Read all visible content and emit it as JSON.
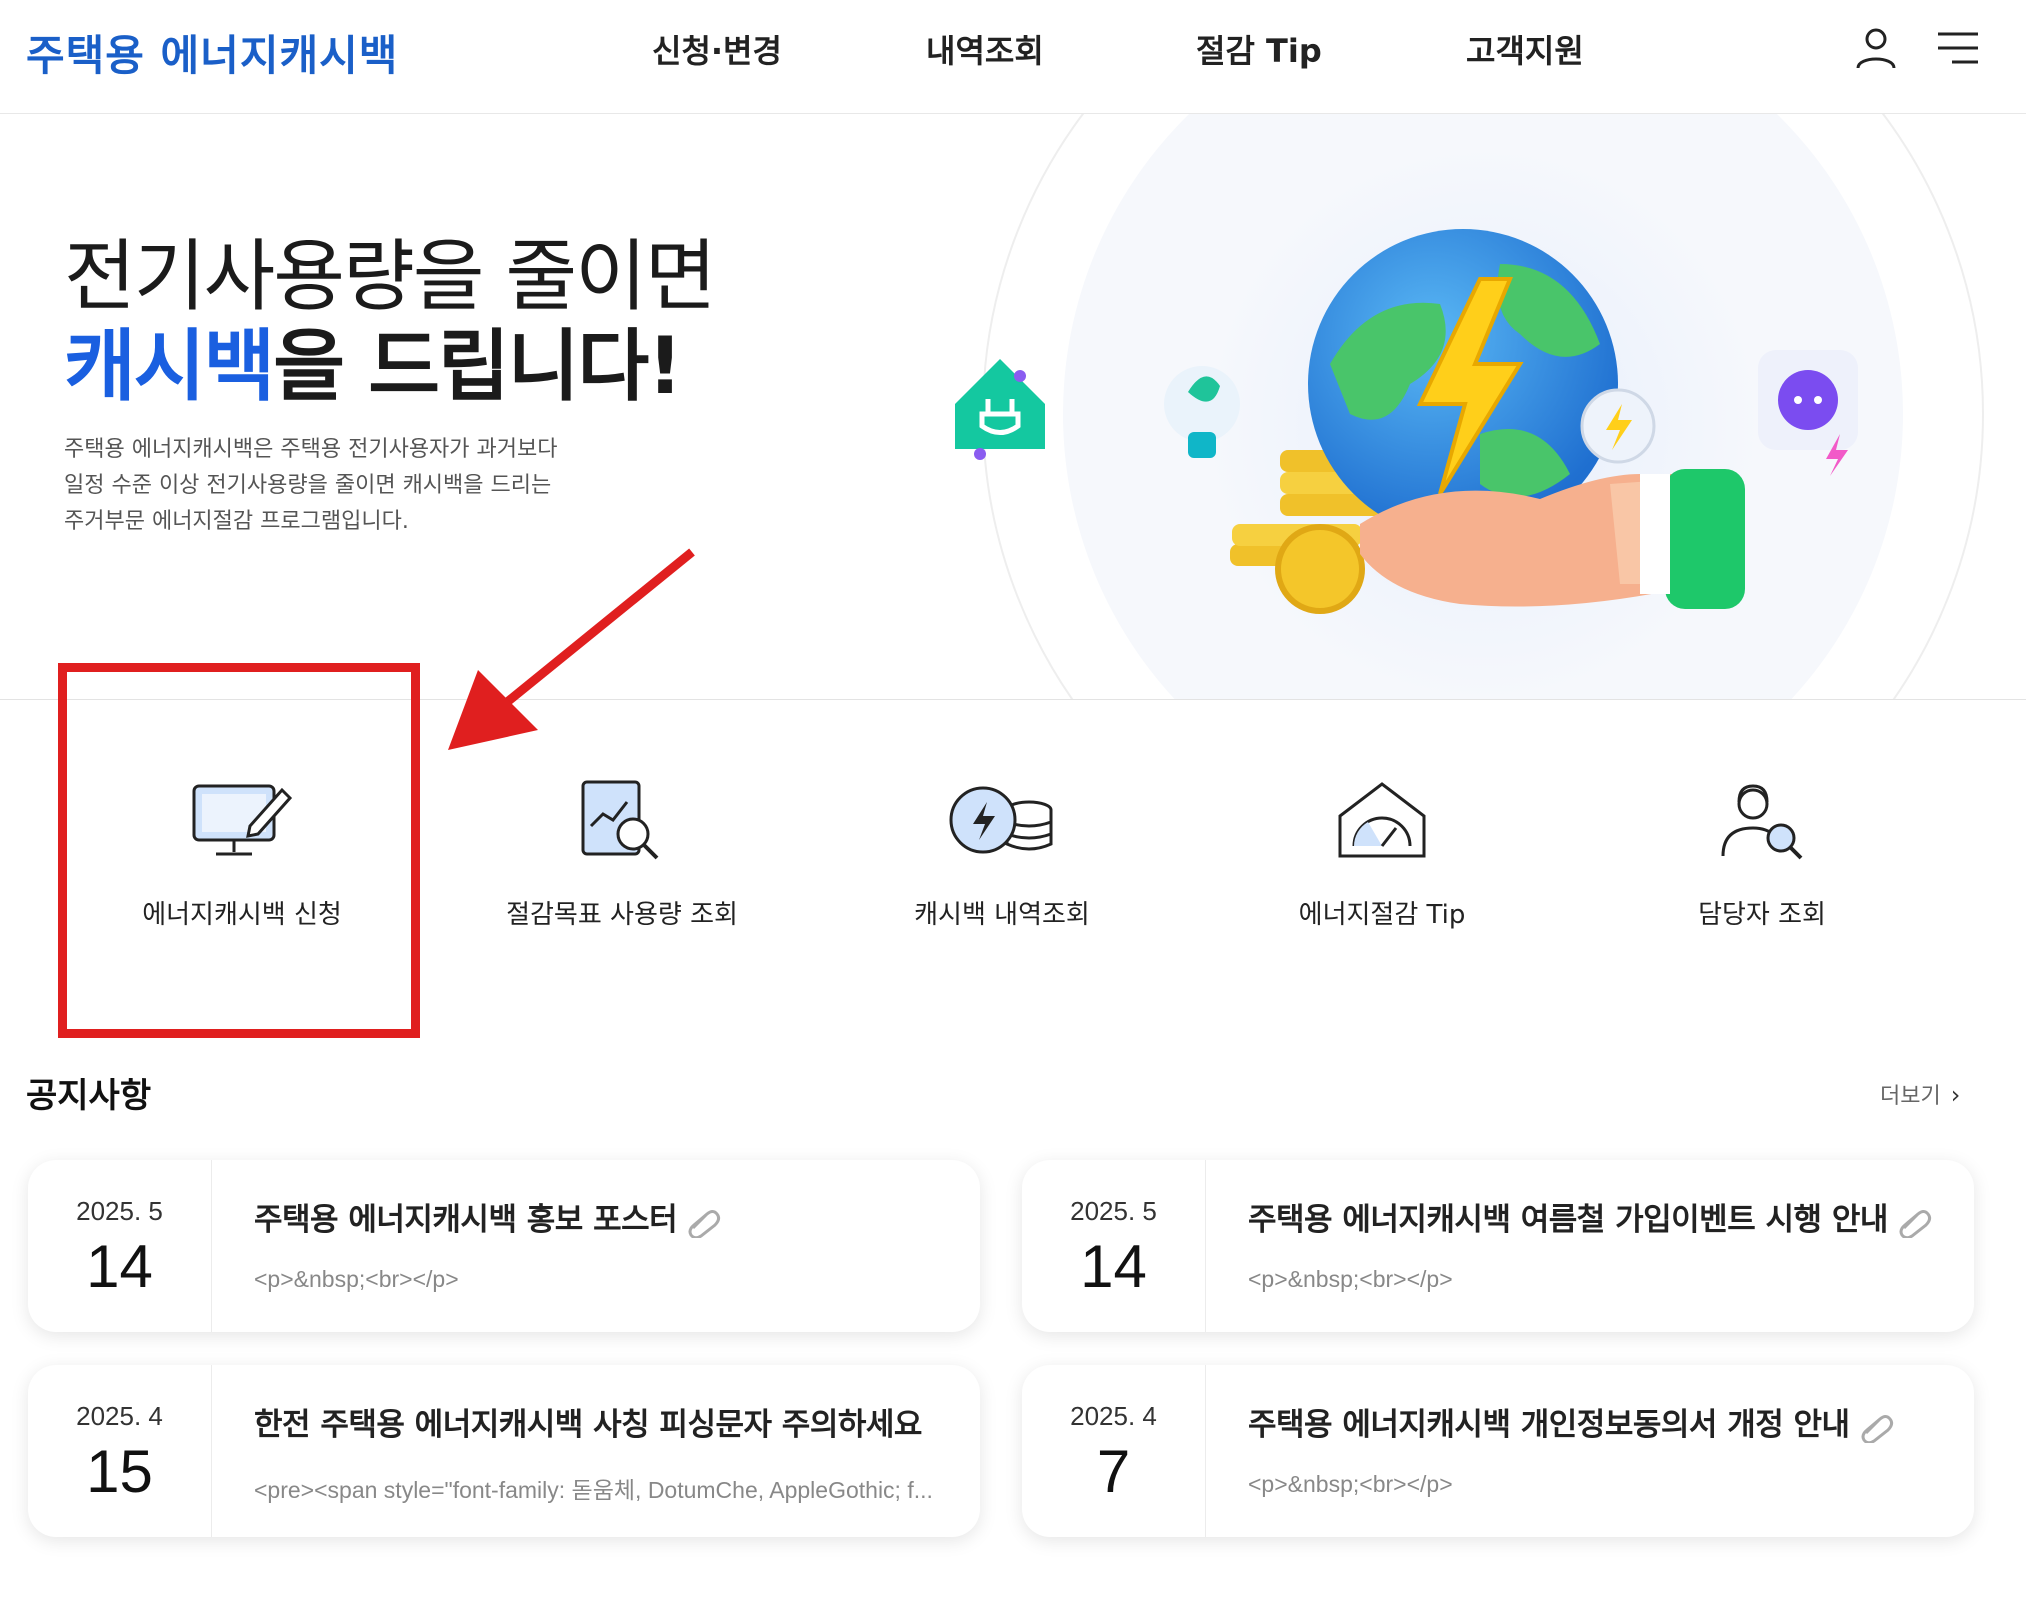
{
  "header": {
    "logo": "주택용 에너지캐시백",
    "nav": [
      "신청·변경",
      "내역조회",
      "절감 Tip",
      "고객지원"
    ],
    "icons": [
      "user-icon",
      "menu-icon"
    ]
  },
  "hero": {
    "title_line1": "전기사용량을 줄이면",
    "title_accent": "캐시백",
    "title_line2_rest": "을 드립니다!",
    "description": [
      "주택용 에너지캐시백은 주택용 전기사용자가 과거보다",
      "일정 수준 이상 전기사용량을 줄이면 캐시백을 드리는",
      "주거부문 에너지절감 프로그램입니다."
    ],
    "accent_color": "#1a5fe0"
  },
  "quick_menu": [
    {
      "label": "에너지캐시백 신청",
      "icon": "monitor-pen-icon"
    },
    {
      "label": "절감목표 사용량 조회",
      "icon": "report-search-icon"
    },
    {
      "label": "캐시백 내역조회",
      "icon": "coin-bolt-icon"
    },
    {
      "label": "에너지절감 Tip",
      "icon": "house-gauge-icon"
    },
    {
      "label": "담당자 조회",
      "icon": "person-search-icon"
    }
  ],
  "notices": {
    "title": "공지사항",
    "more_label": "더보기",
    "items": [
      {
        "ym": "2025. 5",
        "day": "14",
        "headline": "주택용 에너지캐시백 홍보 포스터",
        "snippet": "<p>&nbsp;<br></p>",
        "attachment": true
      },
      {
        "ym": "2025. 5",
        "day": "14",
        "headline": "주택용 에너지캐시백 여름철 가입이벤트 시행 안내",
        "snippet": "<p>&nbsp;<br></p>",
        "attachment": true
      },
      {
        "ym": "2025. 4",
        "day": "15",
        "headline": "한전 주택용 에너지캐시백 사칭 피싱문자 주의하세요",
        "snippet": "<pre><span style=\"font-family: 돋움체, DotumChe, AppleGothic; f...",
        "attachment": false
      },
      {
        "ym": "2025. 4",
        "day": "7",
        "headline": "주택용 에너지캐시백 개인정보동의서 개정 안내",
        "snippet": "<p>&nbsp;<br></p>",
        "attachment": true
      }
    ]
  },
  "annotation_color": "#e01f1f"
}
